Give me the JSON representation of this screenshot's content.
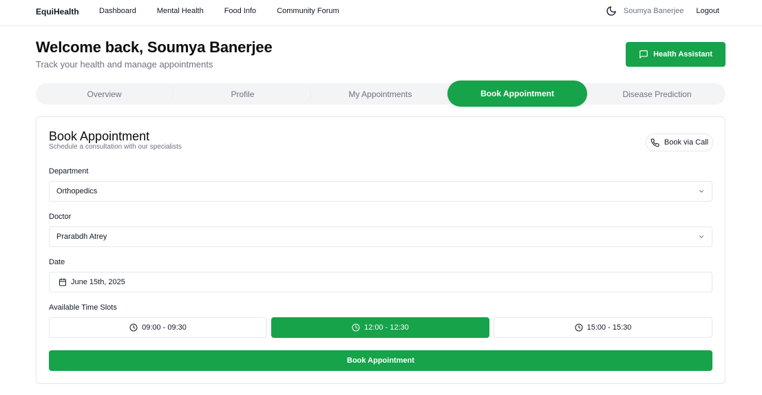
{
  "nav": {
    "brand": "EquiHealth",
    "links": [
      "Dashboard",
      "Mental Health",
      "Food Info",
      "Community Forum"
    ],
    "theme_icon": "moon-icon",
    "user_name": "Soumya Banerjee",
    "logout": "Logout"
  },
  "header": {
    "welcome": "Welcome back, Soumya Banerjee",
    "subtitle": "Track your health and manage appointments",
    "assistant_label": "Health Assistant",
    "assistant_icon": "chat-icon"
  },
  "tabs": [
    {
      "label": "Overview",
      "active": false
    },
    {
      "label": "Profile",
      "active": false
    },
    {
      "label": "My Appointments",
      "active": false
    },
    {
      "label": "Book Appointment",
      "active": true
    },
    {
      "label": "Disease Prediction",
      "active": false
    }
  ],
  "booking": {
    "title": "Book Appointment",
    "subtitle": "Schedule a consultation with our specialists",
    "call_label": "Book via Call",
    "department_label": "Department",
    "department_value": "Orthopedics",
    "doctor_label": "Doctor",
    "doctor_value": "Prarabdh Atrey",
    "date_label": "Date",
    "date_value": "June 15th, 2025",
    "slots_label": "Available Time Slots",
    "slots": [
      {
        "label": "09:00 - 09:30",
        "selected": false
      },
      {
        "label": "12:00 - 12:30",
        "selected": true
      },
      {
        "label": "15:00 - 15:30",
        "selected": false
      }
    ],
    "submit_label": "Book Appointment"
  },
  "colors": {
    "accent": "#16a34a",
    "muted_text": "#6b7280",
    "border": "#e5e7eb",
    "tab_track": "#f3f4f6"
  }
}
